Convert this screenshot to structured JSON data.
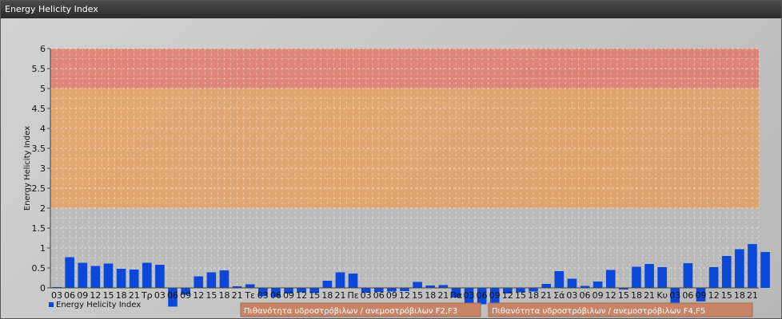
{
  "window": {
    "title": "Energy Helicity Index"
  },
  "colors": {
    "bar": "#0b47d8",
    "band_high": "#e07a68",
    "band_mid": "#e2a062",
    "band_low": "#b8b8b8",
    "band_label_bg": "#c88466"
  },
  "chart_data": {
    "type": "bar",
    "ylabel": "Energy Helicity Index",
    "ylim": [
      -0.5,
      6
    ],
    "yticks": [
      "0",
      "0.5",
      "1",
      "1.5",
      "2",
      "2.5",
      "3",
      "3.5",
      "4",
      "4.5",
      "5",
      "5.5",
      "6"
    ],
    "grid": true,
    "legend": "bottom-left",
    "bands": [
      {
        "from": 0,
        "to": 2,
        "color": "#b8b8b8",
        "label": ""
      },
      {
        "from": 2,
        "to": 5,
        "color": "#e2a062",
        "label": "Πιθανότητα υδροστρόβιλων / ανεμοστρόβιλων F2,F3"
      },
      {
        "from": 5,
        "to": 6,
        "color": "#e07a68",
        "label": "Πιθανότητα υδροστρόβιλων / ανεμοστρόβιλων F4,F5"
      }
    ],
    "categories": [
      "03",
      "06",
      "09",
      "12",
      "15",
      "18",
      "21",
      "Τρ",
      "03",
      "06",
      "09",
      "12",
      "15",
      "18",
      "21",
      "Τε",
      "03",
      "06",
      "09",
      "12",
      "15",
      "18",
      "21",
      "Πε",
      "03",
      "06",
      "09",
      "12",
      "15",
      "18",
      "21",
      "Πα",
      "03",
      "06",
      "09",
      "12",
      "15",
      "18",
      "21",
      "Σά",
      "03",
      "06",
      "09",
      "12",
      "15",
      "18",
      "21",
      "Κυ",
      "03",
      "06",
      "09",
      "12",
      "15",
      "18",
      "21"
    ],
    "series": [
      {
        "name": "Energy Helicity Index",
        "values": [
          0.02,
          0.77,
          0.63,
          0.55,
          0.61,
          0.48,
          0.46,
          0.63,
          0.58,
          -0.47,
          -0.17,
          0.29,
          0.39,
          0.44,
          0.04,
          0.09,
          -0.21,
          -0.23,
          -0.14,
          -0.11,
          -0.13,
          0.18,
          0.39,
          0.36,
          -0.12,
          -0.1,
          -0.09,
          -0.08,
          0.15,
          0.06,
          0.07,
          -0.24,
          -0.39,
          -0.41,
          -0.42,
          -0.14,
          -0.11,
          -0.09,
          0.1,
          0.42,
          0.23,
          0.05,
          0.16,
          0.45,
          -0.04,
          0.53,
          0.6,
          0.52,
          -0.59,
          0.62,
          -0.34,
          0.52,
          0.8,
          0.97,
          1.1,
          0.9
        ]
      }
    ]
  }
}
